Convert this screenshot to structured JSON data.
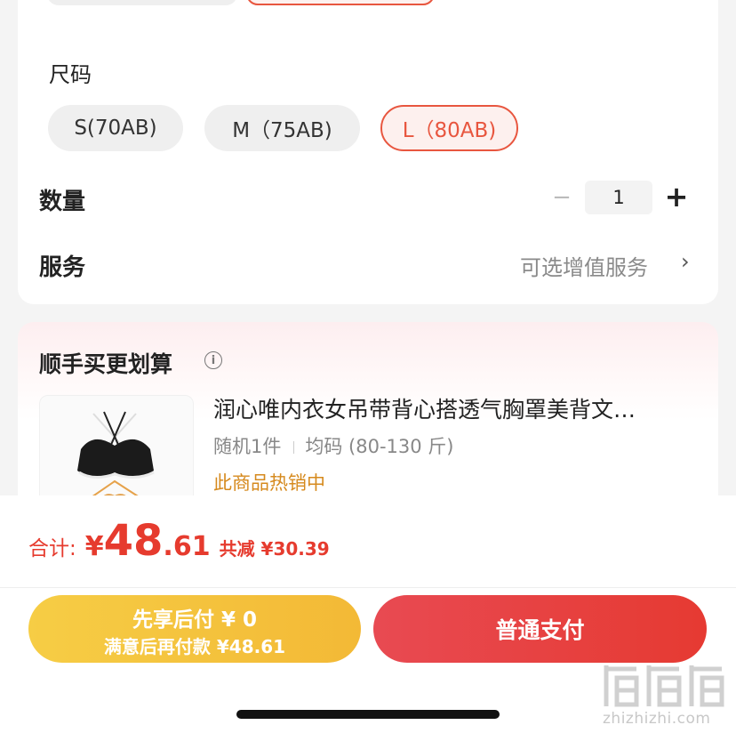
{
  "size": {
    "label": "尺码",
    "options": [
      "S(70AB)",
      "M（75AB)",
      "L（80AB)"
    ],
    "selected": "L（80AB)"
  },
  "quantity": {
    "label": "数量",
    "minus": "−",
    "value": "1",
    "plus": "+"
  },
  "service": {
    "label": "服务",
    "hint": "可选增值服务",
    "chevron": "›"
  },
  "bundle": {
    "title": "顺手买更划算",
    "info_icon": "i",
    "product": {
      "title": "润心唯内衣女吊带背心搭透气胸罩美背文…",
      "count": "随机1件",
      "size": "均码 (80-130 斤)",
      "hot": "此商品热销中"
    }
  },
  "total": {
    "label": "合计:",
    "currency": "¥",
    "integer": "48",
    "decimal": ".61",
    "reduce": "共减 ¥30.39"
  },
  "buttons": {
    "pay_later_line1": "先享后付 ¥ 0",
    "pay_later_line2": "满意后再付款 ¥48.61",
    "pay_normal": "普通支付"
  },
  "watermark": {
    "text": "zhizhizhi.com"
  },
  "colors": {
    "accent": "#e63b2e",
    "selected_border": "#e8563f",
    "pay_later": "#f4c33f",
    "pay_normal": "#e6423a",
    "hot_text": "#d68a1e"
  }
}
